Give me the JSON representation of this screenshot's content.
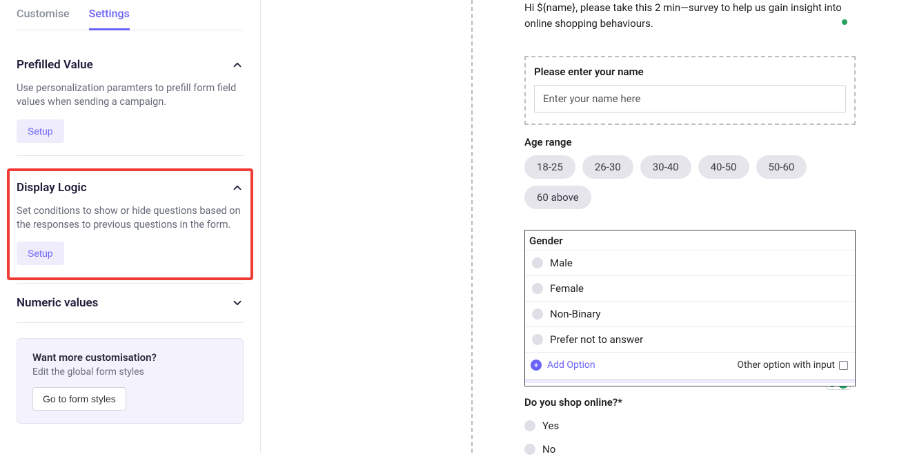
{
  "tabs": {
    "customise": "Customise",
    "settings": "Settings"
  },
  "sections": {
    "prefilled": {
      "title": "Prefilled Value",
      "desc": "Use personalization paramters to prefill form field values when sending a campaign.",
      "btn": "Setup"
    },
    "displayLogic": {
      "title": "Display Logic",
      "desc": "Set conditions to show or hide questions based on the responses to previous questions in the form.",
      "btn": "Setup"
    },
    "numeric": {
      "title": "Numeric values"
    }
  },
  "card": {
    "title": "Want more customisation?",
    "sub": "Edit the global form styles",
    "btn": "Go to form styles"
  },
  "preview": {
    "intro": "Hi ${name}, please take this 2 min—survey to help us gain insight into online shopping behaviours.",
    "name": {
      "label": "Please enter your name",
      "placeholder": "Enter your name here"
    },
    "age": {
      "label": "Age range",
      "options": [
        "18-25",
        "26-30",
        "30-40",
        "40-50",
        "50-60",
        "60 above"
      ]
    },
    "gender": {
      "label": "Gender",
      "options": [
        "Male",
        "Female",
        "Non-Binary",
        "Prefer not to answer"
      ],
      "addOption": "Add Option",
      "otherOption": "Other option with input"
    },
    "shop": {
      "label": "Do you shop online?*",
      "options": [
        "Yes",
        "No"
      ]
    }
  }
}
